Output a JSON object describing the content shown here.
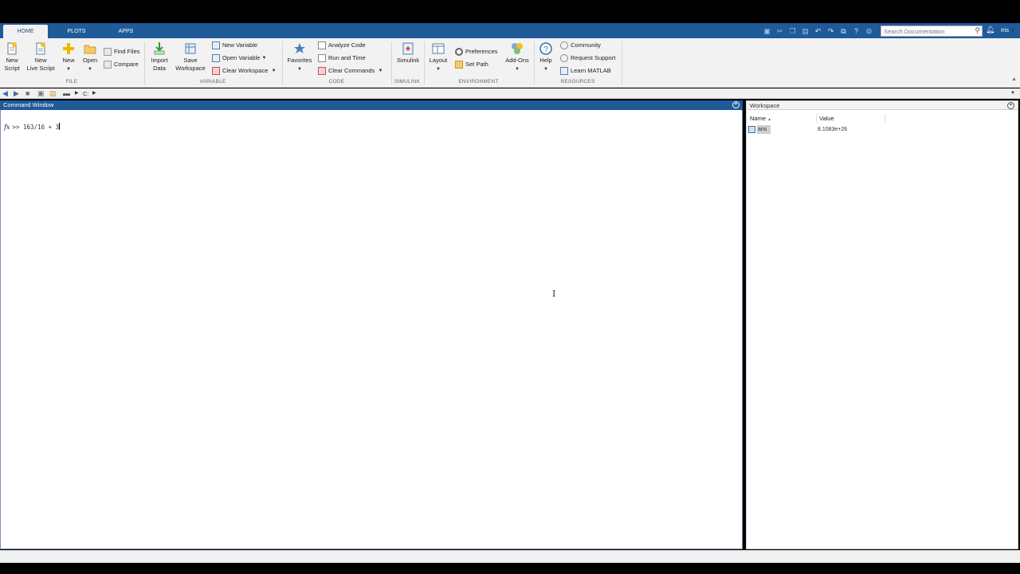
{
  "tabs": [
    {
      "label": "HOME"
    },
    {
      "label": "PLOTS"
    },
    {
      "label": "APPS"
    }
  ],
  "search": {
    "placeholder": "Search Documentation"
  },
  "user": "Iris",
  "ribbon": {
    "file": {
      "new_script": "New\nScript",
      "new_live_script": "New\nLive Script",
      "new": "New",
      "open": "Open",
      "find_files": "Find Files",
      "compare": "Compare",
      "label": "FILE"
    },
    "variable": {
      "import_data": "Import\nData",
      "save_workspace": "Save\nWorkspace",
      "new_variable": "New Variable",
      "open_variable": "Open Variable",
      "clear_workspace": "Clear Workspace",
      "label": "VARIABLE"
    },
    "code": {
      "favorites": "Favorites",
      "analyze_code": "Analyze Code",
      "run_and_time": "Run and Time",
      "clear_commands": "Clear Commands",
      "label": "CODE"
    },
    "simulink": {
      "simulink": "Simulink",
      "label": "SIMULINK"
    },
    "environment": {
      "layout": "Layout",
      "preferences": "Preferences",
      "set_path": "Set Path",
      "add_ons": "Add-Ons",
      "label": "ENVIRONMENT"
    },
    "resources": {
      "help": "Help",
      "community": "Community",
      "request_support": "Request Support",
      "learn_matlab": "Learn MATLAB",
      "label": "RESOURCES"
    }
  },
  "address": {
    "path": "C:"
  },
  "command_window": {
    "title": "Command Window",
    "fx": "fx",
    "prompt": ">>",
    "input": "163/16 + 3"
  },
  "workspace": {
    "title": "Workspace",
    "columns": {
      "name": "Name",
      "value": "Value"
    },
    "rows": [
      {
        "name": "ans",
        "value": "8.1083e+26"
      }
    ]
  },
  "colors": {
    "tab_bar": "#1f5a99",
    "ribbon_bg": "#f2f2f2",
    "command_header": "#1f5a99"
  }
}
